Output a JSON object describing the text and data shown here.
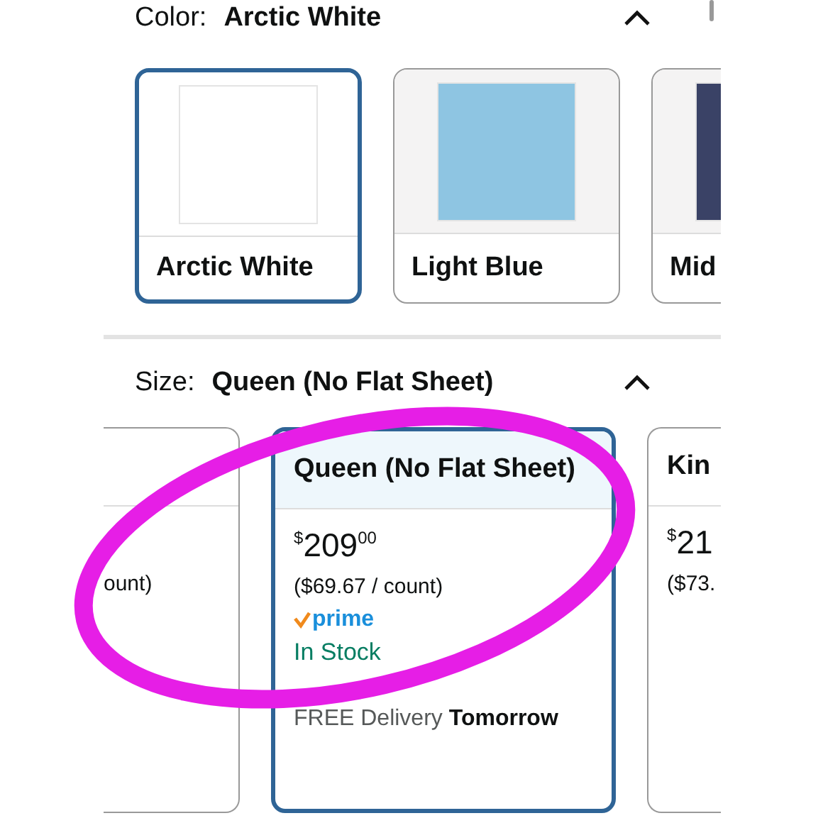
{
  "color_section": {
    "label": "Color:",
    "value": "Arctic White",
    "expanded": true,
    "options": [
      {
        "name": "Arctic White",
        "color": "#ffffff",
        "selected": true
      },
      {
        "name": "Light Blue",
        "color": "#8ec5e2",
        "selected": false
      },
      {
        "name": "Mid",
        "color": "#3a4266",
        "selected": false
      }
    ]
  },
  "size_section": {
    "label": "Size:",
    "value": "Queen (No Flat Sheet)",
    "expanded": true,
    "options": [
      {
        "kind": "cut_left",
        "count": "ount)",
        "selected": false
      },
      {
        "kind": "full",
        "name": "Queen (No Flat Sheet)",
        "currency": "$",
        "price_dollars": "209",
        "price_cents": "00",
        "count": "($69.67 / count)",
        "prime": "prime",
        "stock": "In Stock",
        "delivery": "FREE Delivery **Tomorrow**",
        "selected": true
      },
      {
        "kind": "cut_right",
        "name": "Kin",
        "currency": "$",
        "price_dollars": "21",
        "count": "($73.",
        "selected": false
      }
    ]
  },
  "annotation": {
    "kind": "ellipse",
    "color": "#e61ee6"
  }
}
